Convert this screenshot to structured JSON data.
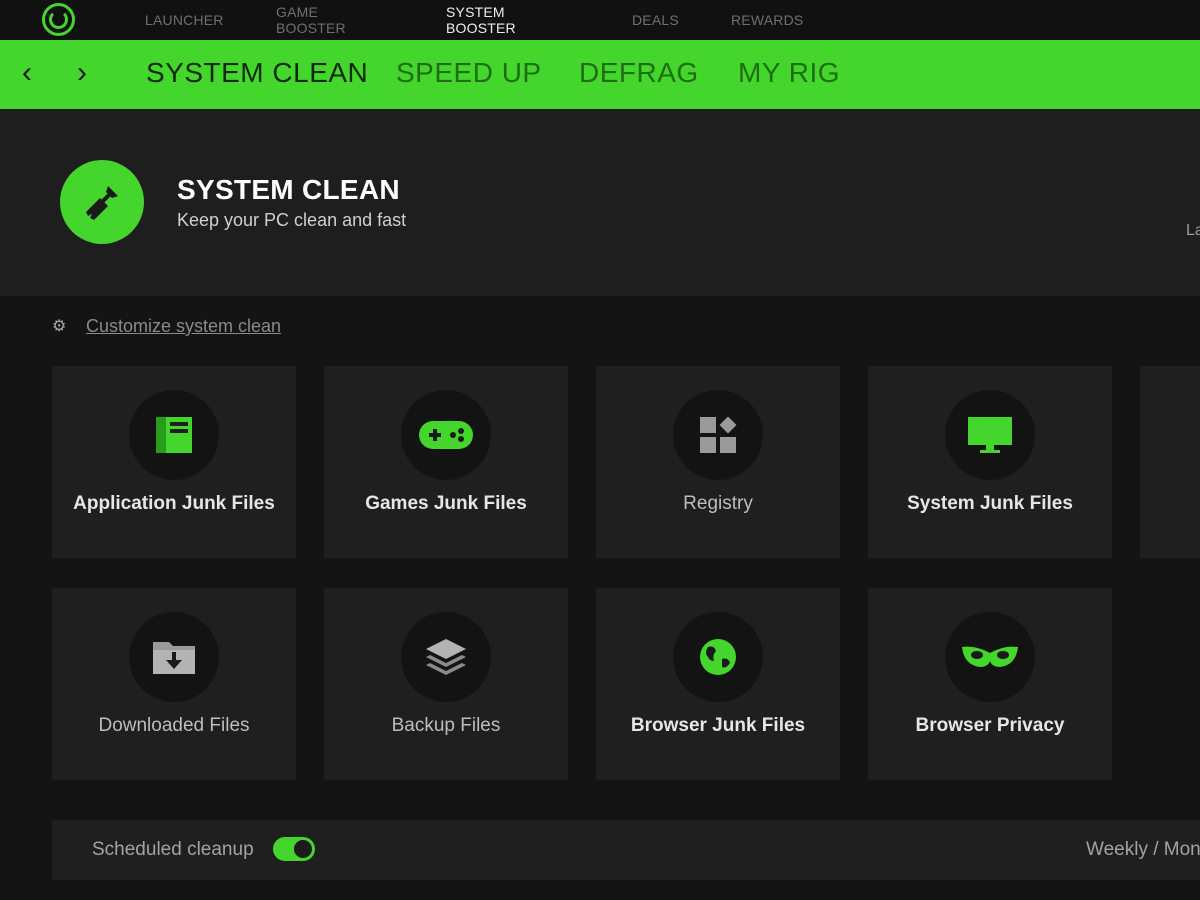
{
  "top_nav": {
    "items": [
      "LAUNCHER",
      "GAME BOOSTER",
      "SYSTEM BOOSTER",
      "DEALS",
      "REWARDS"
    ],
    "active_index": 2
  },
  "sub_nav": {
    "tabs": [
      "SYSTEM CLEAN",
      "SPEED UP",
      "DEFRAG",
      "MY RIG"
    ],
    "active_index": 0
  },
  "hero": {
    "title": "SYSTEM CLEAN",
    "subtitle": "Keep your PC clean and fast",
    "edge_text": "La"
  },
  "customize_link": "Customize system clean",
  "tiles": [
    {
      "label": "Application Junk Files",
      "icon": "application-icon"
    },
    {
      "label": "Games Junk Files",
      "icon": "gamepad-icon"
    },
    {
      "label": "Registry",
      "icon": "registry-icon"
    },
    {
      "label": "System Junk Files",
      "icon": "monitor-icon"
    },
    {
      "label": "Downloaded Files",
      "icon": "download-folder-icon"
    },
    {
      "label": "Backup Files",
      "icon": "layers-icon"
    },
    {
      "label": "Browser Junk Files",
      "icon": "globe-icon"
    },
    {
      "label": "Browser Privacy",
      "icon": "mask-icon"
    }
  ],
  "scheduled": {
    "label": "Scheduled cleanup",
    "enabled": true,
    "frequency": "Weekly / Mon"
  },
  "colors": {
    "accent": "#44d62c",
    "background": "#141414",
    "tile": "#1f1f1f"
  }
}
